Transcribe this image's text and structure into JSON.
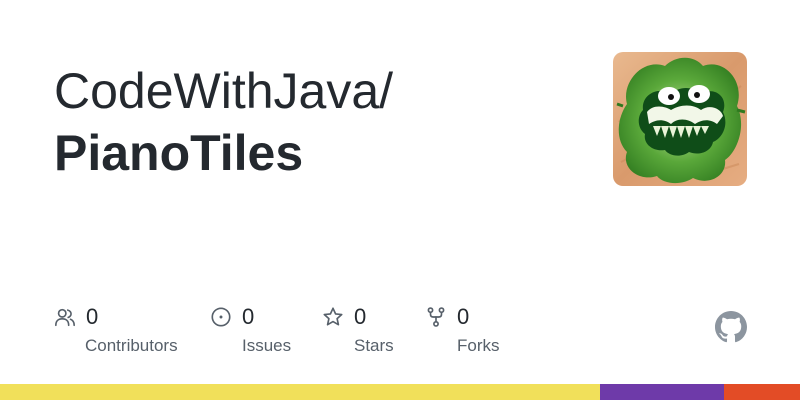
{
  "repo": {
    "owner": "CodeWithJava/",
    "name": "PianoTiles"
  },
  "stats": {
    "contributors": {
      "value": "0",
      "label": "Contributors",
      "icon": "people-icon"
    },
    "issues": {
      "value": "0",
      "label": "Issues",
      "icon": "issue-circle-icon"
    },
    "stars": {
      "value": "0",
      "label": "Stars",
      "icon": "star-icon"
    },
    "forks": {
      "value": "0",
      "label": "Forks",
      "icon": "fork-icon"
    }
  },
  "avatar": {
    "icon": "green-pepper-face-image"
  },
  "github_logo": {
    "icon": "github-mark-icon"
  },
  "language_bar": [
    {
      "color": "#f1e05a",
      "fraction": 0.75
    },
    {
      "color": "#6e3aa9",
      "fraction": 0.155
    },
    {
      "color": "#e34c26",
      "fraction": 0.095
    }
  ],
  "colors": {
    "text": "#24292f",
    "muted": "#57606a",
    "icon": "#57606a"
  }
}
